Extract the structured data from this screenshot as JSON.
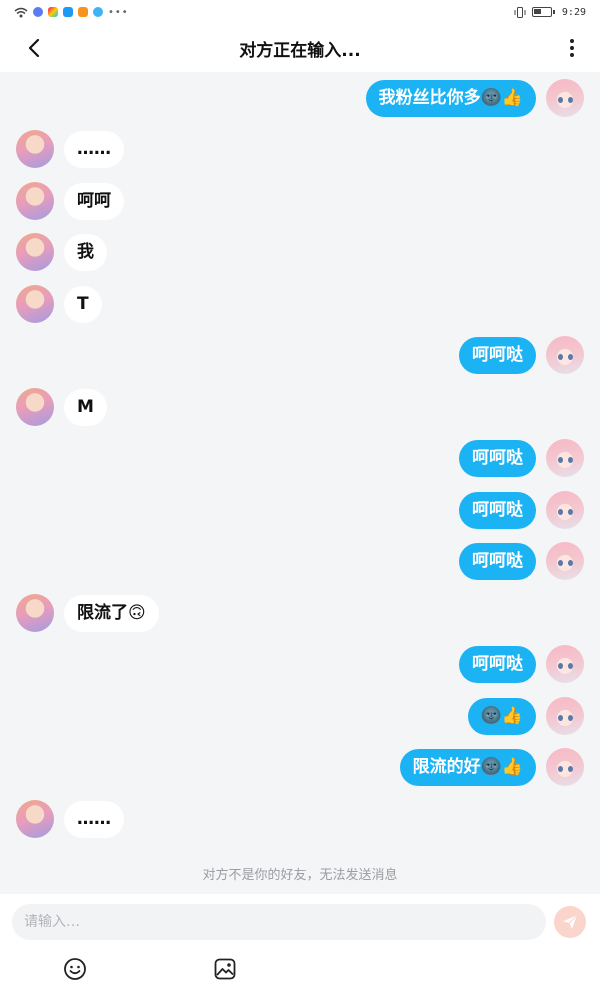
{
  "status_bar": {
    "time": "9:29",
    "icons": [
      "wifi-icon",
      "app-icon",
      "app-icon",
      "app-icon",
      "app-icon",
      "app-icon",
      "more-dots-icon",
      "vibrate-icon",
      "battery-icon"
    ]
  },
  "header": {
    "title": "对方正在输入...",
    "back_icon": "chevron-left-icon",
    "more_icon": "more-vertical-icon"
  },
  "messages": [
    {
      "from": "self",
      "text": "我粉丝比你多🌚👍"
    },
    {
      "from": "other",
      "text": "……"
    },
    {
      "from": "other",
      "text": "呵呵"
    },
    {
      "from": "other",
      "text": "我"
    },
    {
      "from": "other",
      "text": "T"
    },
    {
      "from": "self",
      "text": "呵呵哒"
    },
    {
      "from": "other",
      "text": "M"
    },
    {
      "from": "self",
      "text": "呵呵哒"
    },
    {
      "from": "self",
      "text": "呵呵哒"
    },
    {
      "from": "self",
      "text": "呵呵哒"
    },
    {
      "from": "other",
      "text": "限流了🙃"
    },
    {
      "from": "self",
      "text": "呵呵哒"
    },
    {
      "from": "self",
      "text": "🌚👍"
    },
    {
      "from": "self",
      "text": "限流的好🌚👍"
    },
    {
      "from": "other",
      "text": "……"
    }
  ],
  "notice": "对方不是你的好友，无法发送消息",
  "composer": {
    "placeholder": "请输入…",
    "send_icon": "send-icon",
    "emoji_icon": "emoji-icon",
    "image_icon": "image-icon"
  },
  "colors": {
    "self_bubble": "#1cb3f5",
    "other_bubble": "#ffffff",
    "background": "#f4f5f7",
    "send_button": "#fbd4cc"
  }
}
